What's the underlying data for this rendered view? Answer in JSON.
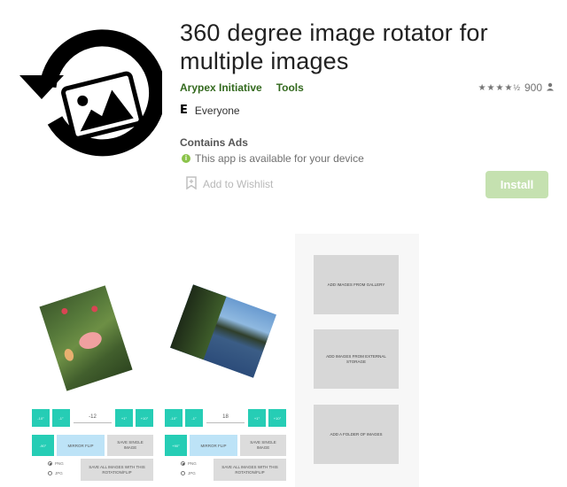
{
  "app": {
    "title": "360 degree image rotator for multiple images",
    "developer": "Arypex Initiative",
    "category": "Tools",
    "rating_stars": "★★★★",
    "rating_half": "½",
    "rating_value": 4.5,
    "rating_count": "900",
    "content_rating_badge": "E",
    "content_rating": "Everyone",
    "contains_ads": "Contains Ads",
    "availability": "This app is available for your device",
    "info_glyph": "i",
    "wishlist_label": "Add to Wishlist",
    "install_label": "Install",
    "colors": {
      "developer_link": "#33691e",
      "install_button": "#c5e1b0",
      "accent_teal": "#26cdb5",
      "mirror_blue": "#bde3f7"
    }
  },
  "icons": {
    "app_icon": "rotate-image-icon",
    "user": "person-icon",
    "wishlist": "bookmark-plus-icon",
    "info": "info-icon"
  },
  "screenshots": [
    {
      "photo": "flower-photo",
      "buttons_row1": [
        "-10°",
        "-1°",
        "+1°",
        "+10°"
      ],
      "angle_value": "-12",
      "rotate_90": "-90°",
      "mirror_label": "MIRROR FLIP",
      "save_single_label": "SAVE SINGLE IMAGE",
      "save_all_label": "SAVE ALL IMAGES WITH THIS ROTATION/FLIP",
      "formats": [
        "PNG",
        "JPG"
      ],
      "selected_format": "PNG"
    },
    {
      "photo": "lake-photo",
      "buttons_row1": [
        "-10°",
        "-1°",
        "+1°",
        "+10°"
      ],
      "angle_value": "18",
      "rotate_90": "+90°",
      "mirror_label": "MIRROR FLIP",
      "save_single_label": "SAVE SINGLE IMAGE",
      "save_all_label": "SAVE ALL IMAGES WITH THIS ROTATION/FLIP",
      "formats": [
        "PNG",
        "JPG"
      ],
      "selected_format": "PNG"
    },
    {
      "options": [
        "ADD IMAGES FROM GALLERY",
        "ADD IMAGES FROM EXTERNAL STORAGE",
        "ADD A FOLDER OF IMAGES"
      ]
    }
  ]
}
